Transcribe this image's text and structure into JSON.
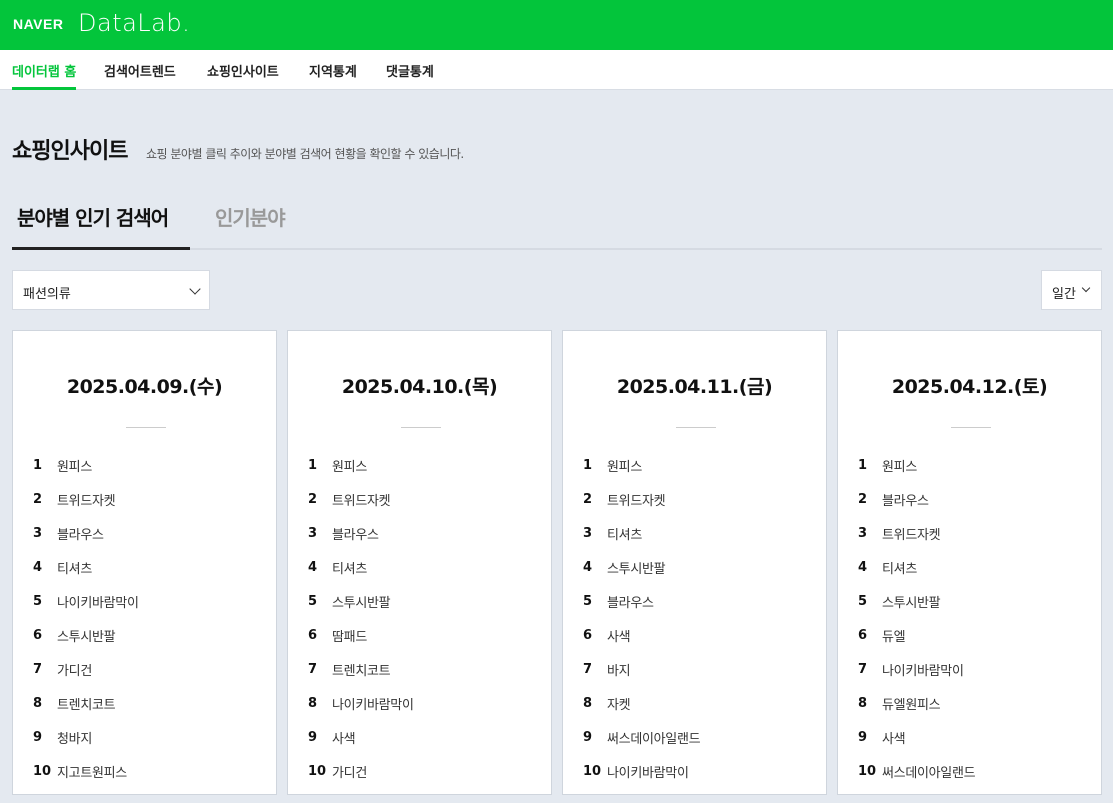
{
  "header": {
    "brand": "NAVER",
    "product": "DataLab."
  },
  "nav": {
    "items": [
      {
        "label": "데이터랩 홈",
        "active": true
      },
      {
        "label": "검색어트렌드",
        "active": false
      },
      {
        "label": "쇼핑인사이트",
        "active": false
      },
      {
        "label": "지역통계",
        "active": false
      },
      {
        "label": "댓글통계",
        "active": false
      }
    ]
  },
  "page": {
    "title": "쇼핑인사이트",
    "description": "쇼핑 분야별 클릭 추이와 분야별 검색어 현황을 확인할 수 있습니다."
  },
  "tabs": [
    {
      "label": "분야별 인기 검색어",
      "active": true
    },
    {
      "label": "인기분야",
      "active": false
    }
  ],
  "filters": {
    "category": "패션의류",
    "period": "일간"
  },
  "cards": [
    {
      "date": "2025.04.09.(수)",
      "keywords": [
        "원피스",
        "트위드자켓",
        "블라우스",
        "티셔츠",
        "나이키바람막이",
        "스투시반팔",
        "가디건",
        "트렌치코트",
        "청바지",
        "지고트원피스"
      ]
    },
    {
      "date": "2025.04.10.(목)",
      "keywords": [
        "원피스",
        "트위드자켓",
        "블라우스",
        "티셔츠",
        "스투시반팔",
        "땀패드",
        "트렌치코트",
        "나이키바람막이",
        "사색",
        "가디건"
      ]
    },
    {
      "date": "2025.04.11.(금)",
      "keywords": [
        "원피스",
        "트위드자켓",
        "티셔츠",
        "스투시반팔",
        "블라우스",
        "사색",
        "바지",
        "자켓",
        "써스데이아일랜드",
        "나이키바람막이"
      ]
    },
    {
      "date": "2025.04.12.(토)",
      "keywords": [
        "원피스",
        "블라우스",
        "트위드자켓",
        "티셔츠",
        "스투시반팔",
        "듀엘",
        "나이키바람막이",
        "듀엘원피스",
        "사색",
        "써스데이아일랜드"
      ]
    }
  ]
}
